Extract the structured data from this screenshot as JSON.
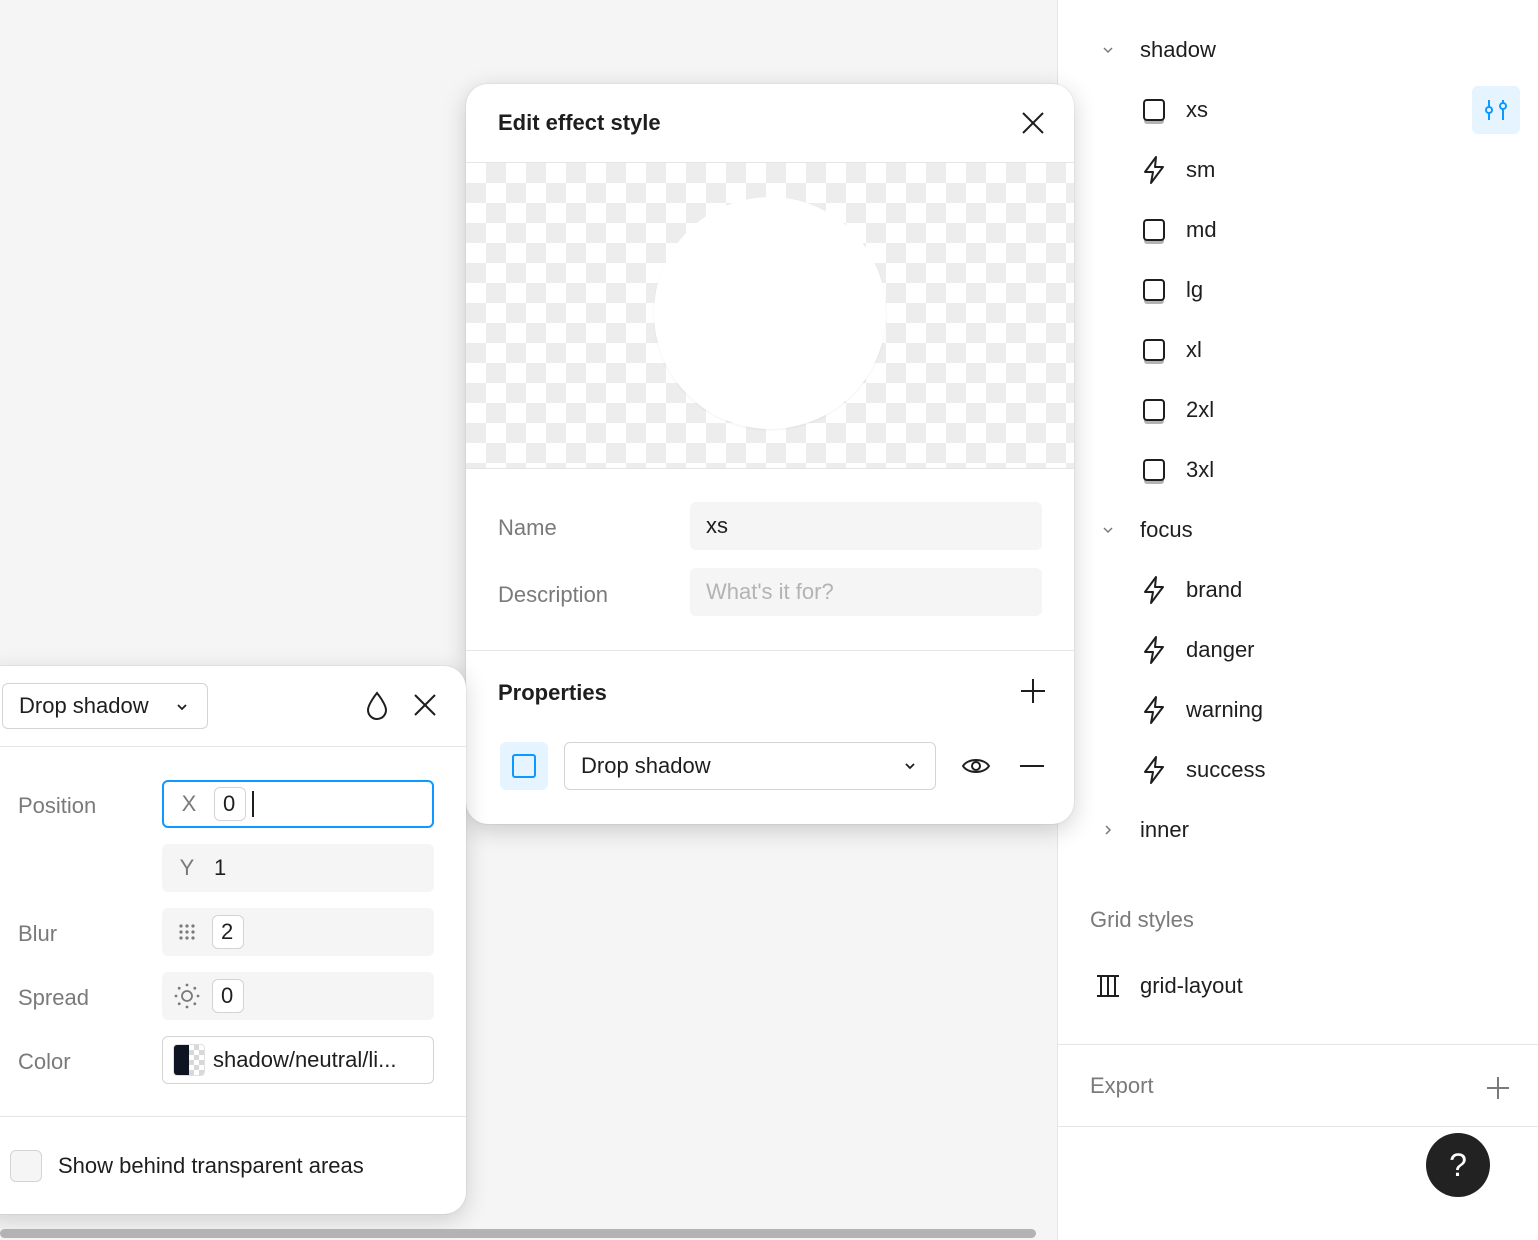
{
  "sidebar": {
    "groups": [
      {
        "label": "shadow",
        "expanded": true,
        "items": [
          {
            "label": "xs",
            "icon": "effect-square-icon"
          },
          {
            "label": "sm",
            "icon": "lightning-icon"
          },
          {
            "label": "md",
            "icon": "effect-square-icon"
          },
          {
            "label": "lg",
            "icon": "effect-square-icon"
          },
          {
            "label": "xl",
            "icon": "effect-square-icon"
          },
          {
            "label": "2xl",
            "icon": "effect-square-icon"
          },
          {
            "label": "3xl",
            "icon": "effect-square-icon"
          }
        ]
      },
      {
        "label": "focus",
        "expanded": true,
        "items": [
          {
            "label": "brand",
            "icon": "lightning-icon"
          },
          {
            "label": "danger",
            "icon": "lightning-icon"
          },
          {
            "label": "warning",
            "icon": "lightning-icon"
          },
          {
            "label": "success",
            "icon": "lightning-icon"
          }
        ]
      },
      {
        "label": "inner",
        "expanded": false,
        "items": []
      }
    ],
    "grid_styles_title": "Grid styles",
    "grid_item_label": "grid-layout",
    "export_title": "Export",
    "help_label": "?"
  },
  "dialog": {
    "title": "Edit effect style",
    "name_label": "Name",
    "name_value": "xs",
    "description_label": "Description",
    "description_placeholder": "What's it for?",
    "properties_title": "Properties",
    "effect_type": "Drop shadow"
  },
  "shadow_panel": {
    "type": "Drop shadow",
    "position_label": "Position",
    "x_prefix": "X",
    "x_value": "0",
    "y_prefix": "Y",
    "y_value": "1",
    "blur_label": "Blur",
    "blur_value": "2",
    "spread_label": "Spread",
    "spread_value": "0",
    "color_label": "Color",
    "color_value": "shadow/neutral/li...",
    "checkbox_label": "Show behind transparent areas"
  },
  "colors": {
    "accent": "#0d99ff",
    "accent_bg": "#e5f4ff",
    "swatch_dark": "#0f1422"
  }
}
